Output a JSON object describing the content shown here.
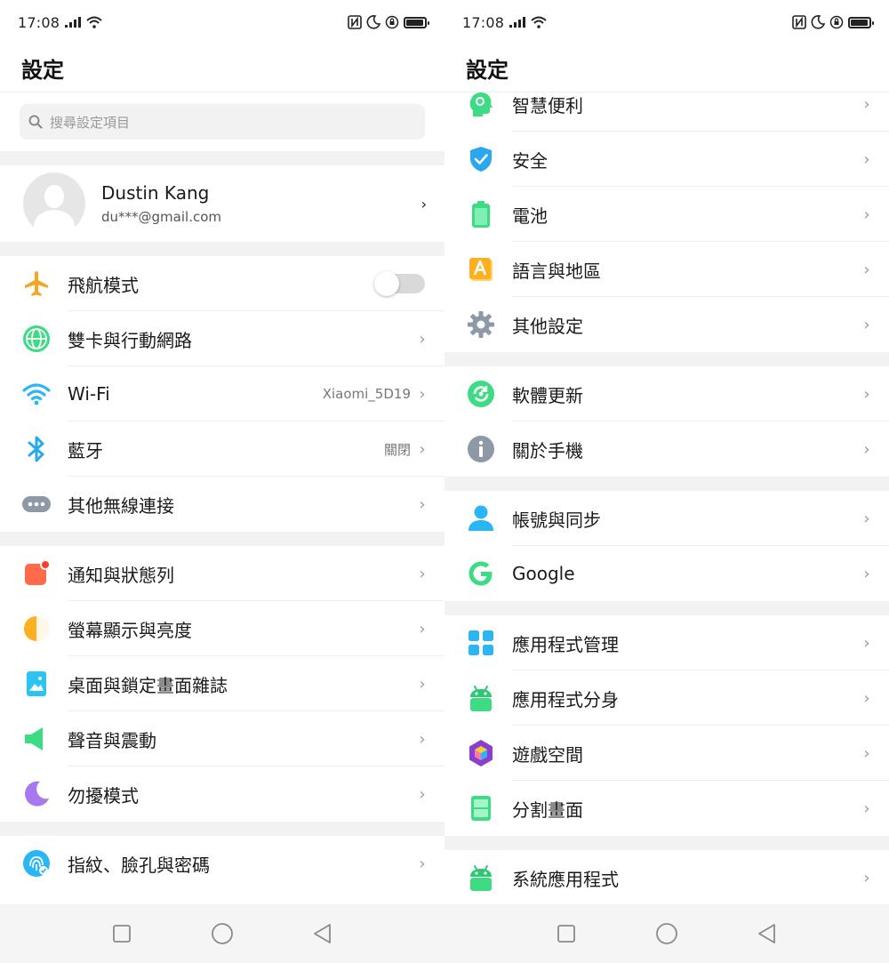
{
  "status_bar": {
    "time": "17:08"
  },
  "title": "設定",
  "search": {
    "placeholder": "搜尋設定項目"
  },
  "profile": {
    "name": "Dustin Kang",
    "email": "du***@gmail.com"
  },
  "left_groups": [
    [
      {
        "id": "airplane",
        "icon": "airplane-icon",
        "label": "飛航模式",
        "toggle": true,
        "toggle_on": false
      },
      {
        "id": "dual-sim",
        "icon": "globe-icon",
        "label": "雙卡與行動網路"
      },
      {
        "id": "wifi",
        "icon": "wifi-icon",
        "label": "Wi-Fi",
        "value": "Xiaomi_5D19"
      },
      {
        "id": "bluetooth",
        "icon": "bluetooth-icon",
        "label": "藍牙",
        "value": "關閉"
      },
      {
        "id": "other-wireless",
        "icon": "more-dots-icon",
        "label": "其他無線連接"
      }
    ],
    [
      {
        "id": "notifications",
        "icon": "notification-icon",
        "label": "通知與狀態列"
      },
      {
        "id": "display",
        "icon": "brightness-icon",
        "label": "螢幕顯示與亮度"
      },
      {
        "id": "wallpaper",
        "icon": "wallpaper-icon",
        "label": "桌面與鎖定畫面雜誌"
      },
      {
        "id": "sound",
        "icon": "speaker-icon",
        "label": "聲音與震動"
      },
      {
        "id": "dnd",
        "icon": "moon-icon",
        "label": "勿擾模式"
      }
    ],
    [
      {
        "id": "fingerprint",
        "icon": "fingerprint-icon",
        "label": "指紋、臉孔與密碼"
      }
    ]
  ],
  "right_groups": [
    [
      {
        "id": "smart",
        "icon": "smart-head-icon",
        "label": "智慧便利"
      },
      {
        "id": "security",
        "icon": "shield-icon",
        "label": "安全"
      },
      {
        "id": "battery",
        "icon": "battery-icon",
        "label": "電池"
      },
      {
        "id": "language",
        "icon": "language-icon",
        "label": "語言與地區"
      },
      {
        "id": "other-settings",
        "icon": "gear-icon",
        "label": "其他設定"
      }
    ],
    [
      {
        "id": "software-update",
        "icon": "update-icon",
        "label": "軟體更新"
      },
      {
        "id": "about",
        "icon": "info-icon",
        "label": "關於手機"
      }
    ],
    [
      {
        "id": "accounts",
        "icon": "person-icon",
        "label": "帳號與同步"
      },
      {
        "id": "google",
        "icon": "google-icon",
        "label": "Google"
      }
    ],
    [
      {
        "id": "app-manager",
        "icon": "apps-grid-icon",
        "label": "應用程式管理"
      },
      {
        "id": "app-clone",
        "icon": "android-icon",
        "label": "應用程式分身"
      },
      {
        "id": "game-space",
        "icon": "game-cube-icon",
        "label": "遊戲空間"
      },
      {
        "id": "split-screen",
        "icon": "split-screen-icon",
        "label": "分割畫面"
      }
    ],
    [
      {
        "id": "system-apps",
        "icon": "android-icon",
        "label": "系統應用程式"
      }
    ]
  ],
  "colors": {
    "airplane": "#f5a623",
    "globe": "#3ddc84",
    "wifi": "#29b6f6",
    "bluetooth": "#29a8f0",
    "dots": "#8e99a8",
    "notification": "#ff6b4a",
    "brightness": "#ffb020",
    "wallpaper": "#29c4f2",
    "speaker": "#3ddc84",
    "moon": "#a878f0",
    "fingerprint": "#29b6f6",
    "smart": "#3ddc84",
    "shield": "#29a8f0",
    "battery": "#3ddc84",
    "language": "#ffb020",
    "gear": "#8e99a8",
    "update": "#3ddc84",
    "info": "#8e99a8",
    "person": "#29b6f6",
    "google": "#3ddc84",
    "apps": "#29b6f6",
    "game": "#8a3fd1",
    "split": "#3ddc84"
  }
}
